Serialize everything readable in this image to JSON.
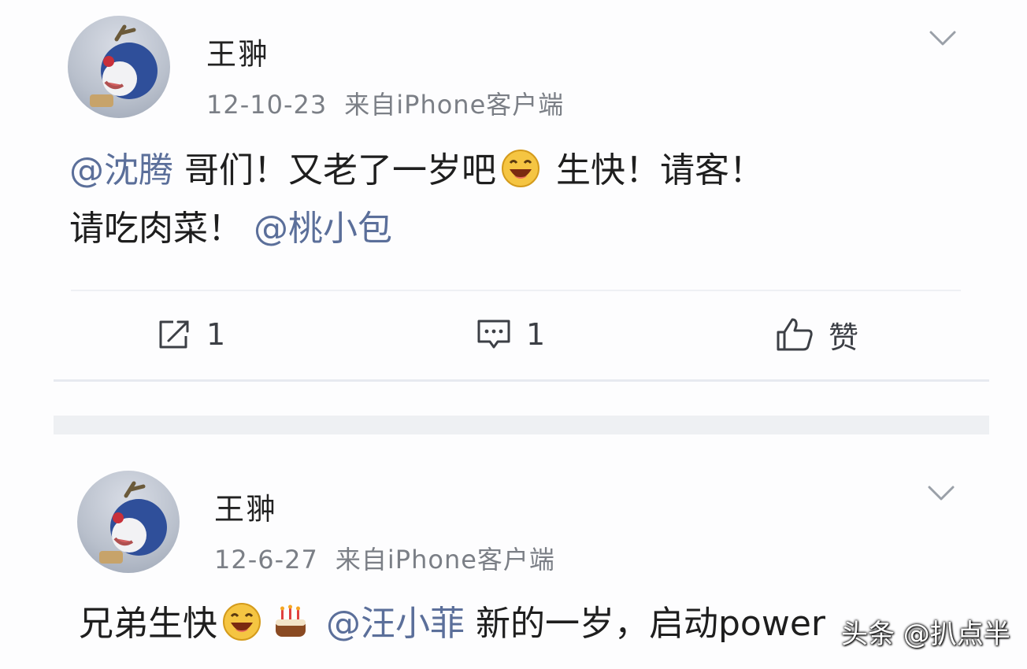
{
  "posts": [
    {
      "username": "王翀",
      "date": "12-10-23",
      "source": "来自iPhone客户端",
      "content": {
        "mention1": "@沈腾",
        "text1": " 哥们！又老了一岁吧",
        "text2": " 生快！请客！",
        "text3": "请吃肉菜！",
        "mention2": "@桃小包"
      },
      "actions": {
        "share_count": "1",
        "comment_count": "1",
        "like_label": "赞"
      }
    },
    {
      "username": "王翀",
      "date": "12-6-27",
      "source": "来自iPhone客户端",
      "content": {
        "text1": "兄弟生快",
        "mention1": "@汪小菲",
        "text2": " 新的一岁，启动power"
      }
    }
  ],
  "watermark": "头条 @扒点半",
  "colors": {
    "mention": "#5b6f9a",
    "meta": "#7b7f86",
    "background": "#fdfdfe"
  },
  "icons": [
    "menu-chevron-icon",
    "share-icon",
    "comment-icon",
    "thumbs-up-icon",
    "laughing-emoji-icon",
    "cake-emoji-icon"
  ]
}
